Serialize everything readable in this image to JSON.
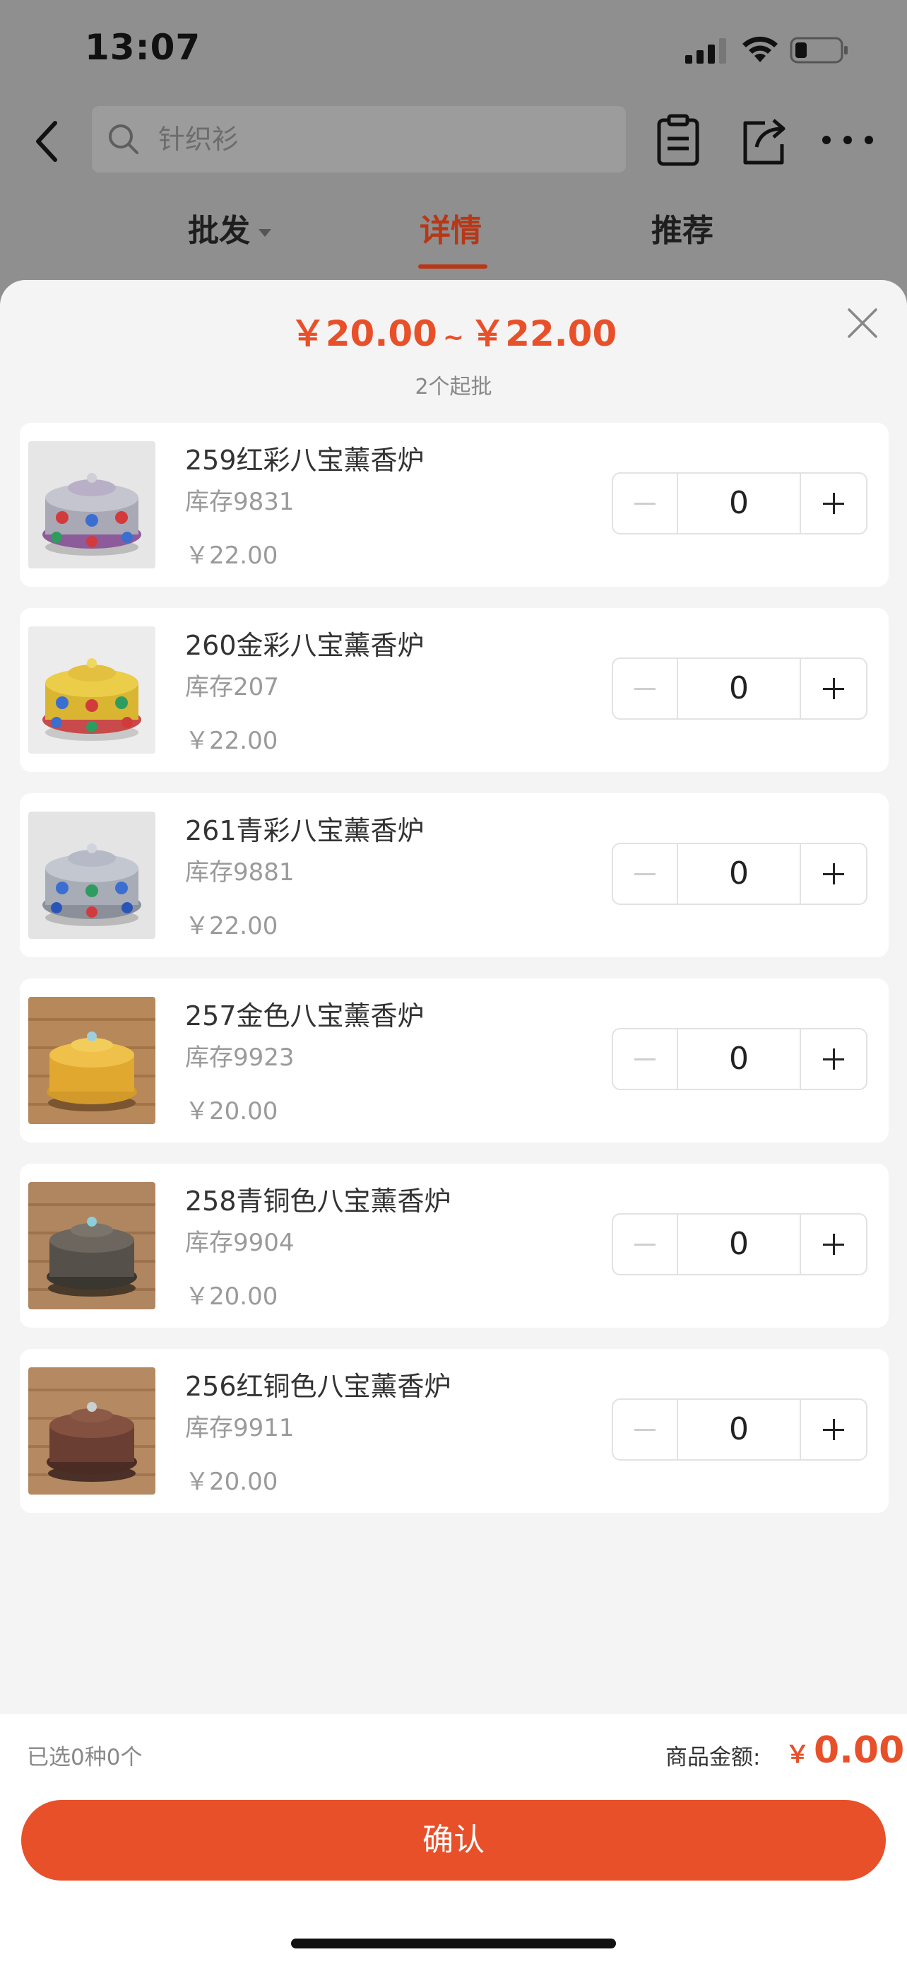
{
  "status_bar": {
    "time": "13:07"
  },
  "nav": {
    "search_placeholder": "针织衫"
  },
  "tabs": [
    {
      "label": "批发",
      "active": false,
      "has_caret": true
    },
    {
      "label": "详情",
      "active": true
    },
    {
      "label": "推荐",
      "active": false
    }
  ],
  "sheet": {
    "price_min": "￥20.00",
    "price_sep": "~",
    "price_max": "￥22.00",
    "min_batch": "2个起批",
    "items": [
      {
        "name": "259红彩八宝薰香炉",
        "stock": "库存9831",
        "price": "￥22.00",
        "qty": "0",
        "image": "silver-burner-red-blue-gems"
      },
      {
        "name": "260金彩八宝薰香炉",
        "stock": "库存207",
        "price": "￥22.00",
        "qty": "0",
        "image": "gold-burner-colored-gems"
      },
      {
        "name": "261青彩八宝薰香炉",
        "stock": "库存9881",
        "price": "￥22.00",
        "qty": "0",
        "image": "silver-burner-blue-gems"
      },
      {
        "name": "257金色八宝薰香炉",
        "stock": "库存9923",
        "price": "￥20.00",
        "qty": "0",
        "image": "gold-burner-on-bamboo-mat"
      },
      {
        "name": "258青铜色八宝薰香炉",
        "stock": "库存9904",
        "price": "￥20.00",
        "qty": "0",
        "image": "bronze-burner-on-bamboo-mat"
      },
      {
        "name": "256红铜色八宝薰香炉",
        "stock": "库存9911",
        "price": "￥20.00",
        "qty": "0",
        "image": "copper-burner-on-bamboo-mat"
      }
    ]
  },
  "footer": {
    "selected": "已选0种0个",
    "total_label": "商品金额:",
    "total_currency": "￥",
    "total_value": "0.00",
    "confirm_label": "确认"
  },
  "colors": {
    "accent": "#e8502a",
    "tab_active": "#b83716",
    "overlay_bg": "#8f8f8f",
    "sheet_bg": "#f4f4f4"
  }
}
